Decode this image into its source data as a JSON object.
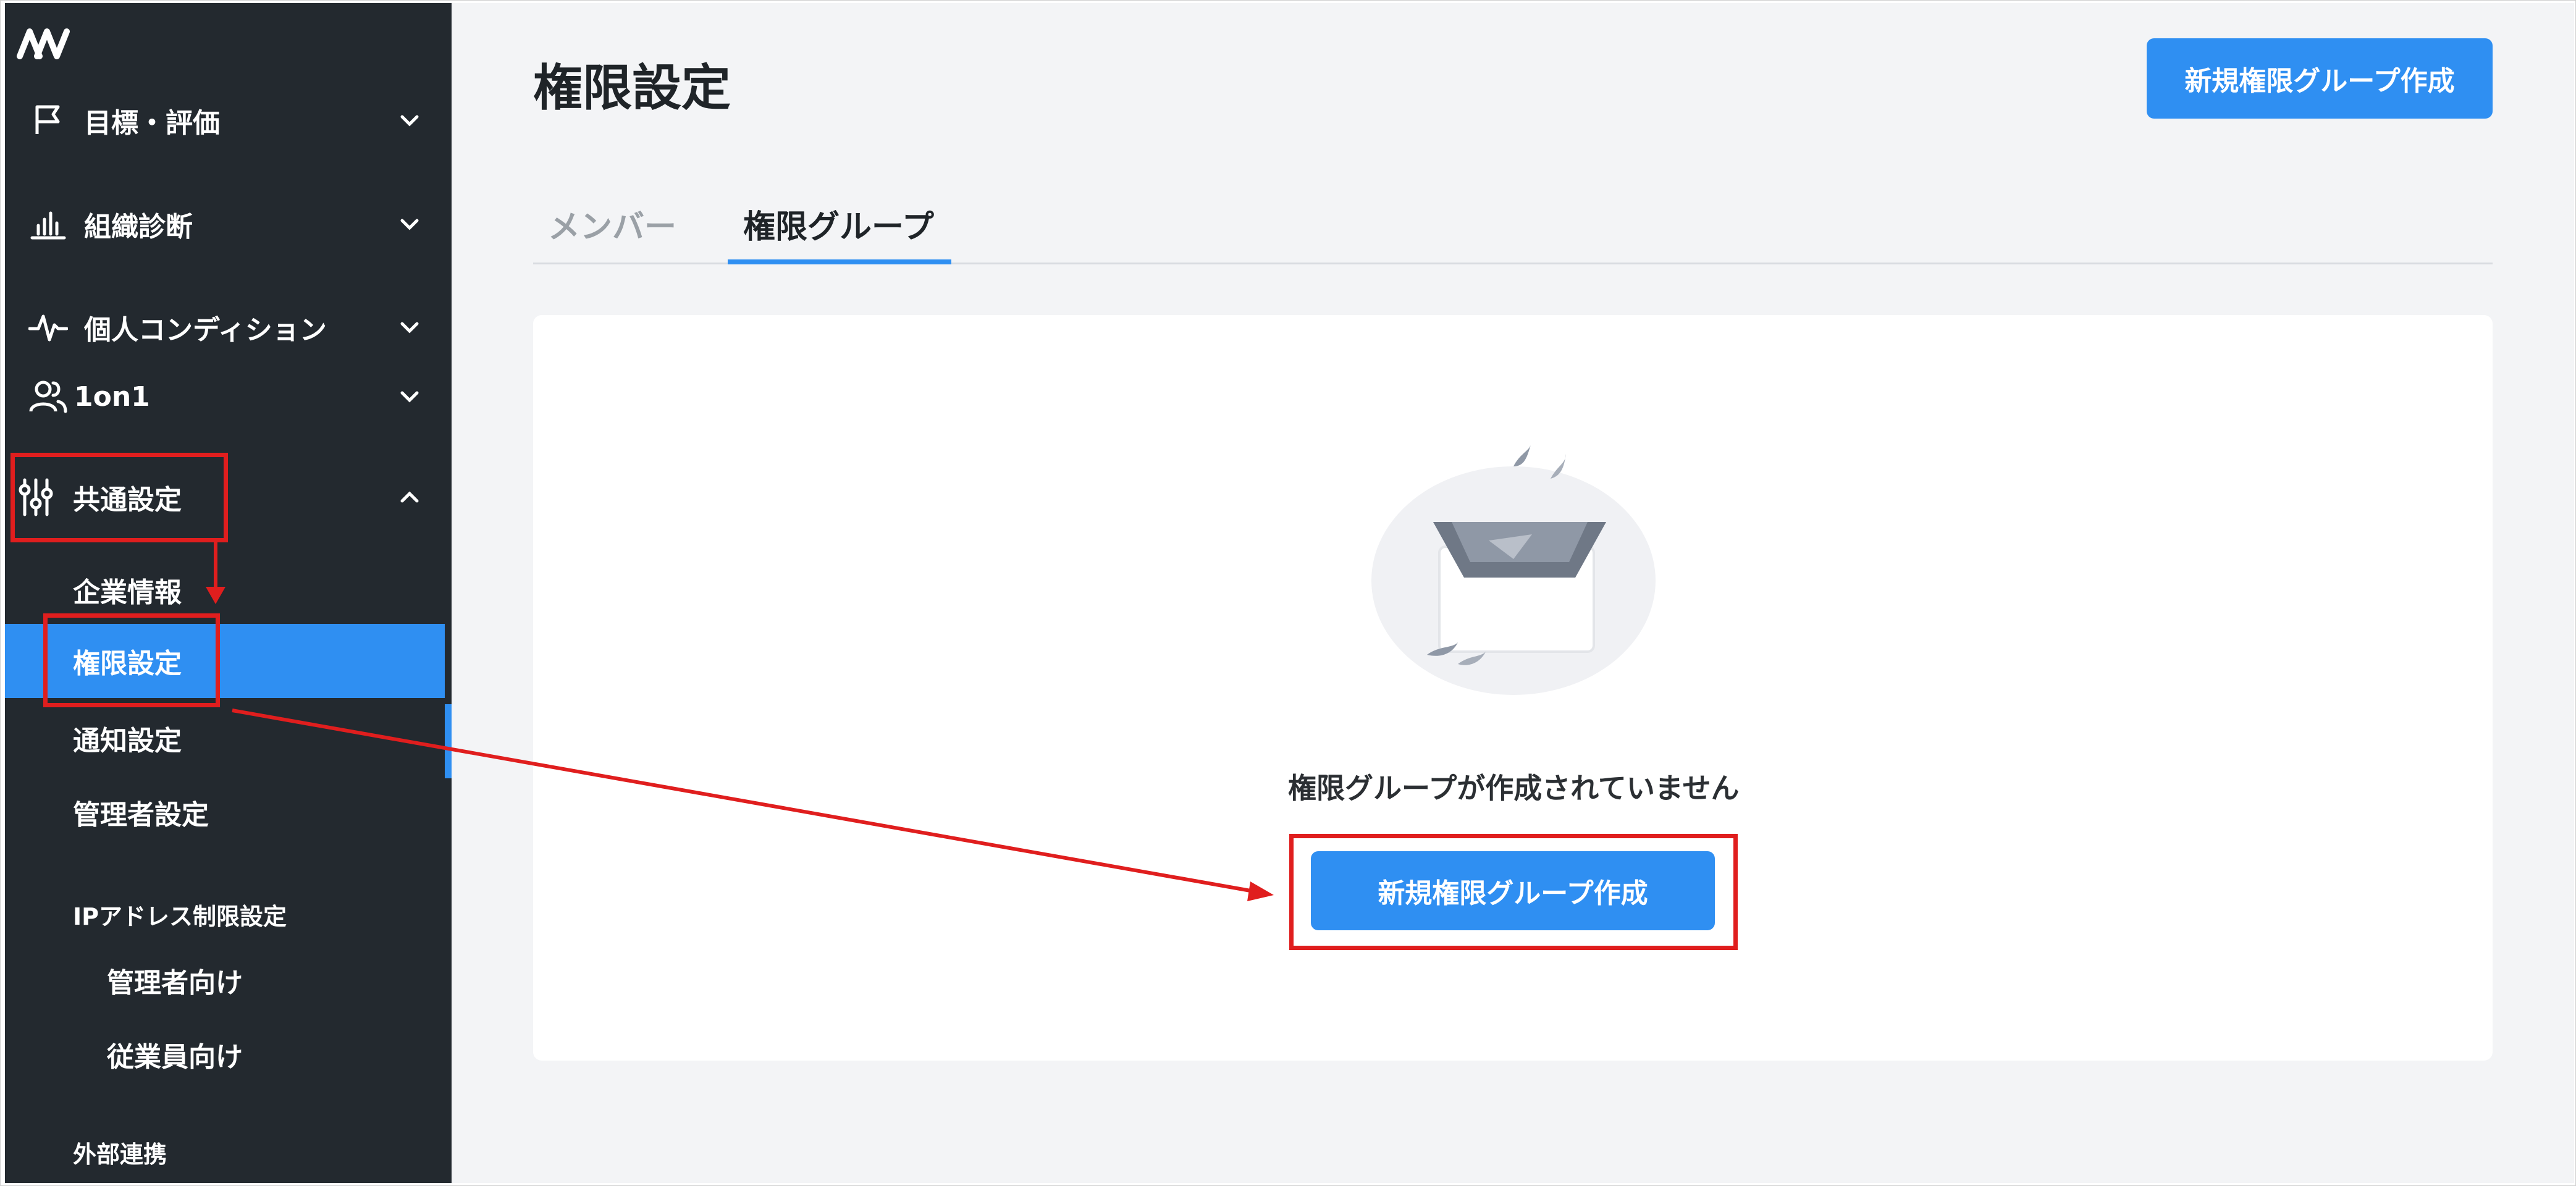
{
  "sidebar": {
    "nav": [
      {
        "label": "目標・評価",
        "icon": "flag-icon"
      },
      {
        "label": "組織診断",
        "icon": "bar-chart-icon"
      },
      {
        "label": "個人コンディション",
        "icon": "pulse-icon"
      },
      {
        "label": "1on1",
        "icon": "users-icon"
      },
      {
        "label": "共通設定",
        "icon": "sliders-icon"
      }
    ],
    "sub_items": [
      "企業情報",
      "権限設定",
      "通知設定",
      "管理者設定"
    ],
    "ip_group": {
      "title": "IPアドレス制限設定",
      "items": [
        "管理者向け",
        "従業員向け"
      ]
    },
    "external": "外部連携"
  },
  "header": {
    "title": "権限設定",
    "new_group_button": "新規権限グループ作成"
  },
  "tabs": [
    "メンバー",
    "権限グループ"
  ],
  "empty_state": {
    "message": "権限グループが作成されていません",
    "button": "新規権限グループ作成"
  },
  "colors": {
    "sidebar_bg": "#23292f",
    "accent": "#2f8ff2",
    "annotation_red": "#e01e1e",
    "main_bg": "#f3f4f6"
  }
}
